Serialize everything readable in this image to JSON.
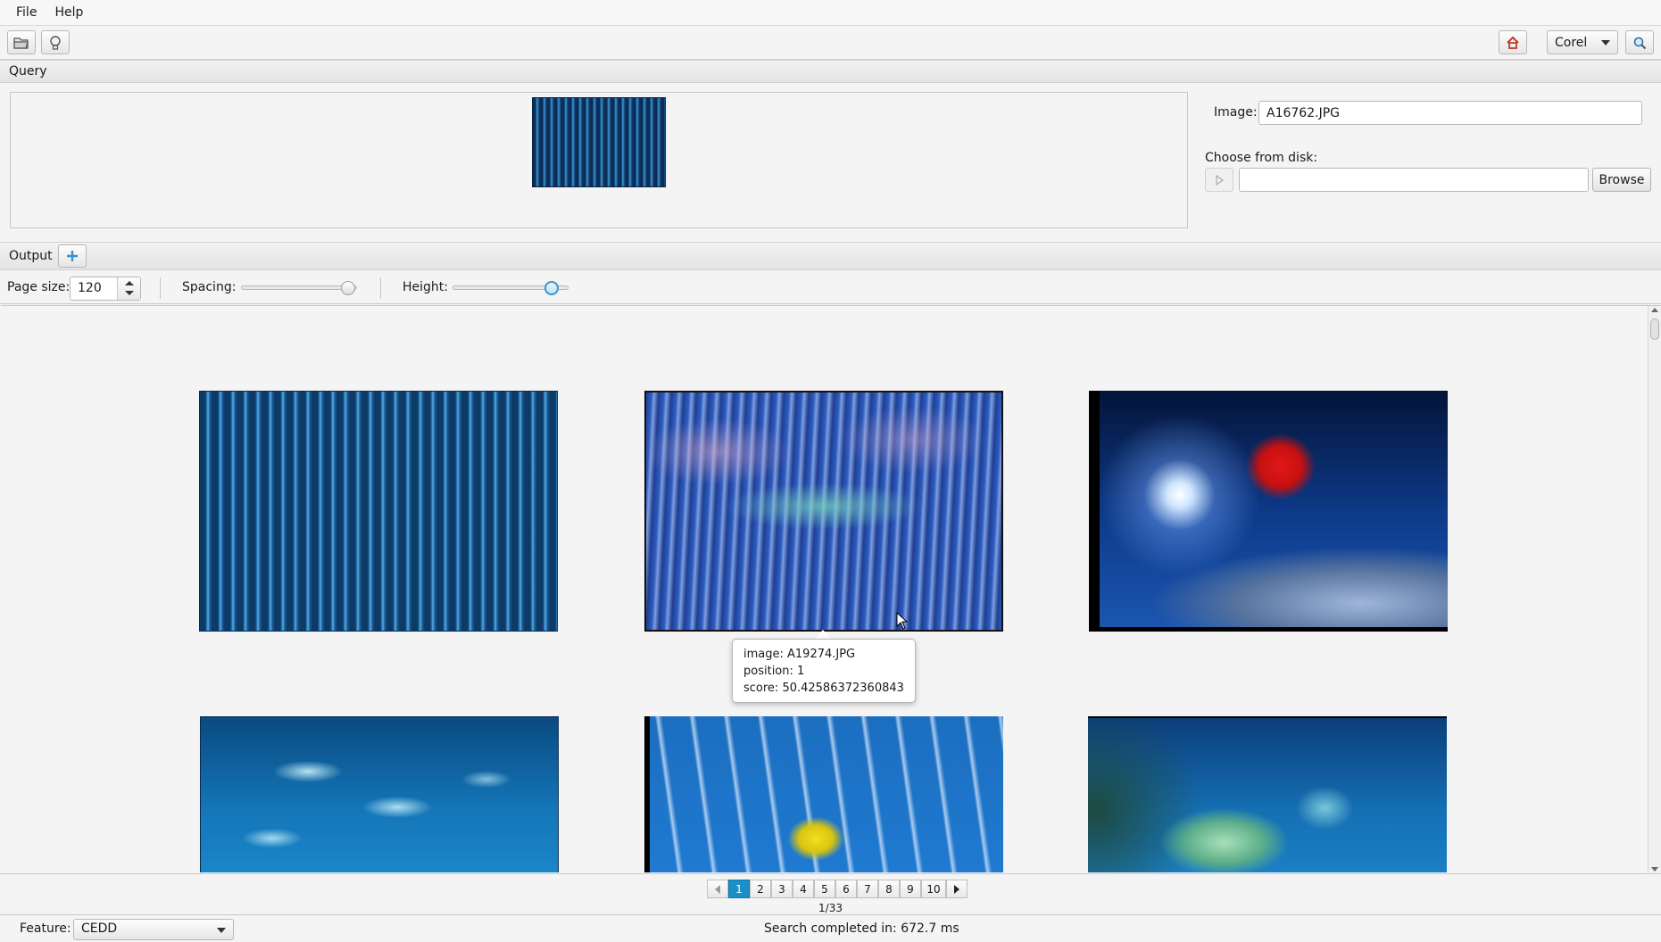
{
  "menu": {
    "file": "File",
    "help": "Help"
  },
  "toolbar": {
    "open_icon": "folder-open-icon",
    "hint_icon": "lightbulb-icon",
    "home_icon": "home-icon",
    "dataset": "Corel",
    "search_icon": "magnifier-icon"
  },
  "query": {
    "header": "Query",
    "image_label": "Image:",
    "image_value": "A16762.JPG",
    "choose_label": "Choose from disk:",
    "path_value": "",
    "browse_label": "Browse"
  },
  "output": {
    "header": "Output",
    "add_icon": "plus-icon",
    "page_size_label": "Page size:",
    "page_size_value": "120",
    "spacing_label": "Spacing:",
    "spacing_level": 0.9,
    "height_label": "Height:",
    "height_level": 0.85
  },
  "results": [
    {
      "image": "query-stripes"
    },
    {
      "image": "reef"
    },
    {
      "image": "diver"
    },
    {
      "image": "fish"
    },
    {
      "image": "ski"
    },
    {
      "image": "turtle"
    }
  ],
  "tooltip": {
    "image_line": "image: A19274.JPG",
    "position_line": "position: 1",
    "score_line": "score: 50.42586372360843"
  },
  "pagination": {
    "pages": [
      "1",
      "2",
      "3",
      "4",
      "5",
      "6",
      "7",
      "8",
      "9",
      "10"
    ],
    "active_page": "1",
    "page_count": "1/33"
  },
  "status": {
    "feature_label": "Feature:",
    "feature_value": "CEDD",
    "message": "Search completed in: 672.7 ms"
  },
  "colors": {
    "accent": "#1a90c8",
    "home_icon": "#c0392b"
  }
}
